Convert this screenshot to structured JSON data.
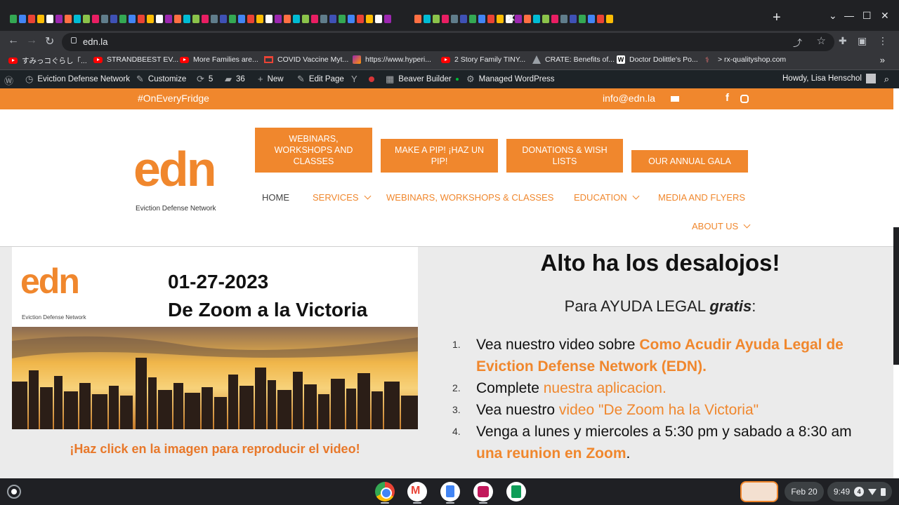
{
  "browser": {
    "tab_close": "✕",
    "new_tab": "+",
    "url": "edn.la",
    "bookmarks": [
      {
        "icon": "youtube",
        "label": "すみっコぐらし「..."
      },
      {
        "icon": "youtube",
        "label": "STRANDBEEST EV..."
      },
      {
        "icon": "youtube",
        "label": "More Families are..."
      },
      {
        "icon": "gmail",
        "label": "COVID Vaccine Myt..."
      },
      {
        "icon": "hyperiums",
        "label": "https://www.hyperi..."
      },
      {
        "icon": "youtube",
        "label": "2 Story Family TINY..."
      },
      {
        "icon": "crate",
        "label": "CRATE: Benefits of..."
      },
      {
        "icon": "wikipedia",
        "label": "Doctor Dolittle's Po..."
      },
      {
        "icon": "rx",
        "label": "> rx-qualityshop.com"
      }
    ],
    "bookmarks_more": "»"
  },
  "wpadmin": {
    "site_name": "Eviction Defense Network",
    "customize": "Customize",
    "updates_count": "5",
    "comments_count": "36",
    "new_label": "New",
    "edit_page": "Edit Page",
    "beaver_builder": "Beaver Builder",
    "managed_wp": "Managed WordPress",
    "howdy": "Howdy, Lisa Henschol"
  },
  "site": {
    "topbar": {
      "hashtag": "#OnEveryFridge",
      "email": "info@edn.la"
    },
    "logo": {
      "mark": "edn",
      "tagline": "Eviction Defense Network"
    },
    "cta_buttons": [
      "WEBINARS, WORKSHOPS AND CLASSES",
      "MAKE A PIP! ¡HAZ UN PIP!",
      "DONATIONS & WISH LISTS",
      "OUR ANNUAL GALA"
    ],
    "nav": {
      "home": "HOME",
      "services": "SERVICES",
      "webinars": "WEBINARS, WORKSHOPS & CLASSES",
      "education": "EDUCATION",
      "media": "MEDIA AND FLYERS",
      "about": "ABOUT US"
    },
    "feature": {
      "logo_mark": "edn",
      "logo_tag": "Eviction Defense Network",
      "date": "01-27-2023",
      "title": "De Zoom a la Victoria",
      "caption": "¡Haz click en la imagen para reproducir el video!"
    },
    "heading": "Alto ha los desalojos!",
    "subhead_pre": "Para AYUDA LEGAL ",
    "subhead_em": "gratis",
    "subhead_post": ":",
    "steps": [
      {
        "num": "1.",
        "pre": "Vea nuestro video sobre ",
        "link": "Como Acudir Ayuda Legal de Eviction Defense Network (EDN).",
        "post": ""
      },
      {
        "num": "2.",
        "pre": "Complete ",
        "link": "nuestra aplicacion.",
        "post": ""
      },
      {
        "num": "3.",
        "pre": "Vea nuestro ",
        "link": "video \"De Zoom ha la Victoria\"",
        "post": ""
      },
      {
        "num": "4.",
        "pre": "Venga a lunes y miercoles a 5:30 pm y sabado a 8:30 am ",
        "link": "una reunion en Zoom",
        "post": "."
      }
    ]
  },
  "shelf": {
    "date": "Feb 20",
    "notif_count": "4",
    "time": "9:49"
  },
  "colors": {
    "brand_orange": "#f0872d",
    "wp_admin_bg": "#1d2327",
    "browser_bg": "#202124"
  }
}
